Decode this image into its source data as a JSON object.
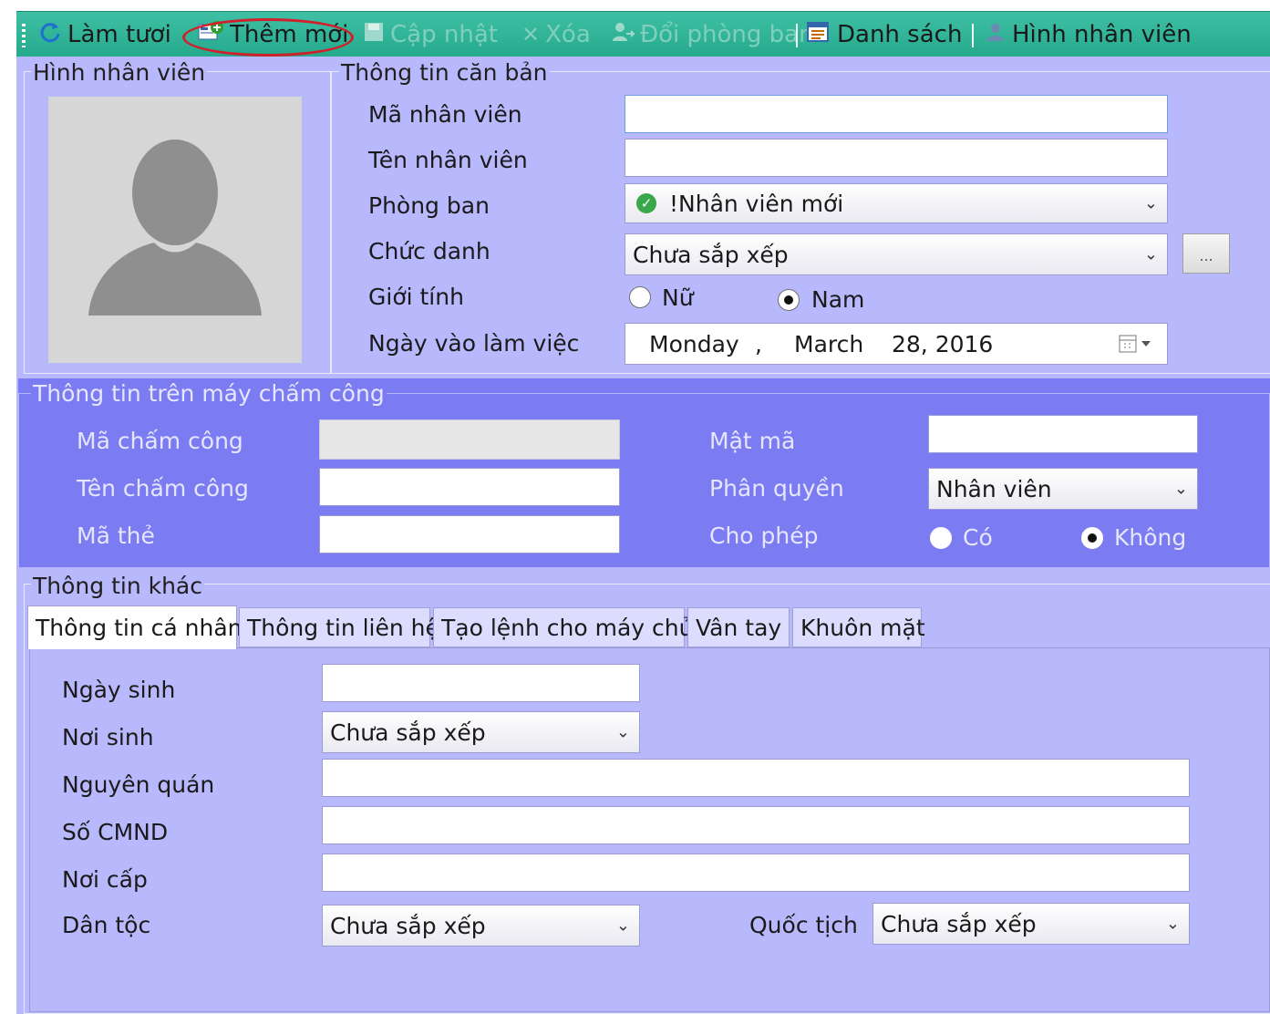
{
  "toolbar": {
    "refresh": "Làm tươi",
    "add_new": "Thêm mới",
    "update": "Cập nhật",
    "delete": "Xóa",
    "change_department": "Đổi phòng ban",
    "list": "Danh sách",
    "employee_photo": "Hình nhân viên"
  },
  "photo_group": {
    "legend": "Hình nhân viên"
  },
  "basic_info": {
    "legend": "Thông tin căn bản",
    "employee_id_label": "Mã nhân viên",
    "employee_id_value": "",
    "employee_name_label": "Tên nhân viên",
    "employee_name_value": "",
    "department_label": "Phòng ban",
    "department_value": "!Nhân viên mới",
    "title_label": "Chức danh",
    "title_value": "Chưa sắp xếp",
    "title_more": "...",
    "gender_label": "Giới tính",
    "gender_female": "Nữ",
    "gender_male": "Nam",
    "gender_selected": "Nam",
    "start_date_label": "Ngày vào làm việc",
    "start_date_weekday": "Monday",
    "start_date_comma": ",",
    "start_date_month": "March",
    "start_date_daytime": "28, 2016"
  },
  "punch_info": {
    "legend": "Thông tin trên máy chấm công",
    "punch_id_label": "Mã chấm công",
    "punch_name_label": "Tên chấm công",
    "card_label": "Mã thẻ",
    "password_label": "Mật mã",
    "permission_label": "Phân quyền",
    "permission_value": "Nhân viên",
    "allow_label": "Cho phép",
    "allow_yes": "Có",
    "allow_no": "Không",
    "allow_selected": "Không"
  },
  "other_info": {
    "legend": "Thông tin khác",
    "tabs": [
      "Thông tin cá nhân",
      "Thông tin liên hệ",
      "Tạo lệnh cho máy chủ",
      "Vân tay",
      "Khuôn mặt"
    ],
    "active_tab": "Thông tin cá nhân",
    "birthday_label": "Ngày sinh",
    "birthplace_label": "Nơi sinh",
    "birthplace_value": "Chưa sắp xếp",
    "hometown_label": "Nguyên quán",
    "id_number_label": "Số CMND",
    "issue_place_label": "Nơi cấp",
    "ethnicity_label": "Dân tộc",
    "ethnicity_value": "Chưa sắp xếp",
    "nationality_label": "Quốc tịch",
    "nationality_value": "Chưa sắp xếp"
  },
  "colors": {
    "toolbar": "#2fb598",
    "panel": "#b8b8fc",
    "punch_section": "#7b7bf2",
    "highlight": "#d0202a"
  }
}
